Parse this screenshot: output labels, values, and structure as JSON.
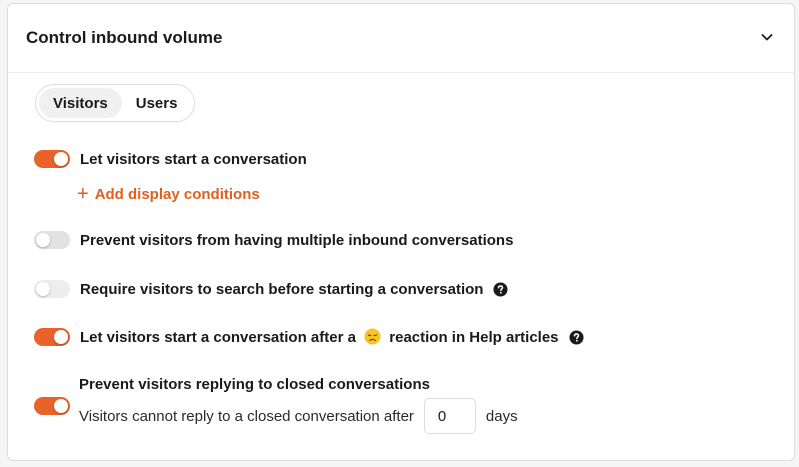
{
  "section": {
    "title": "Control inbound volume",
    "collapse_icon": "chevron-down-icon"
  },
  "tabs": [
    {
      "label": "Visitors",
      "active": true
    },
    {
      "label": "Users",
      "active": false
    }
  ],
  "settings": [
    {
      "label": "Let visitors start a conversation",
      "enabled": true
    },
    {
      "label": "Prevent visitors from having multiple inbound conversations",
      "enabled": false
    },
    {
      "label": "Require visitors to search before starting a conversation",
      "enabled": false,
      "help_icon": "question-circle-icon"
    },
    {
      "label_before": "Let visitors start a conversation after a",
      "emoji": "disappointed-face-emoji",
      "label_after": "reaction in Help articles",
      "enabled": true,
      "help_icon": "question-circle-icon"
    },
    {
      "label": "Prevent visitors replying to closed conversations",
      "enabled": true
    }
  ],
  "add_conditions": {
    "icon": "plus-icon",
    "label": "Add display conditions"
  },
  "closed_reply": {
    "prefix": "Visitors cannot reply to a closed conversation after",
    "value": "0",
    "suffix": "days"
  },
  "colors": {
    "accent": "#e8622a",
    "toggle_off": "#e2e2e2",
    "text": "#1a1a1a"
  }
}
